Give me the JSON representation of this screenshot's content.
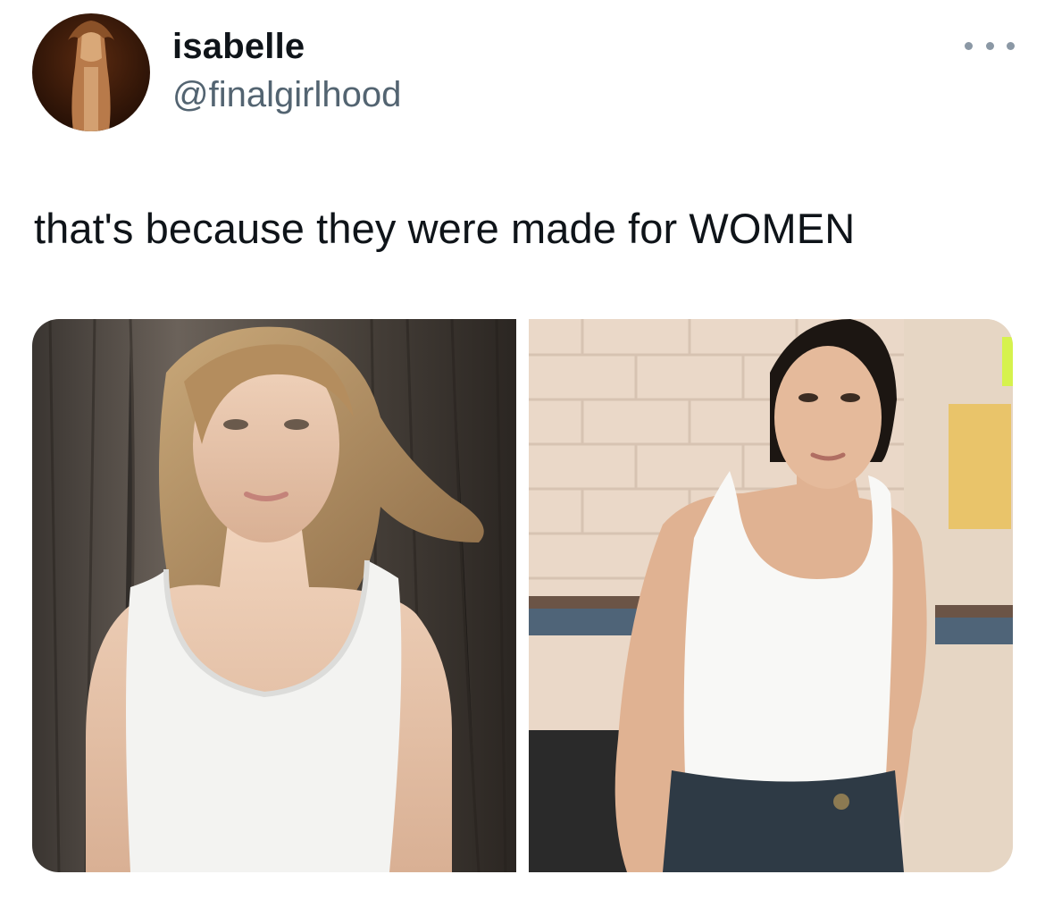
{
  "author": {
    "display_name": "isabelle",
    "handle": "@finalgirlhood",
    "avatar_icon": "profile-photo"
  },
  "menu": {
    "icon": "more-options-icon"
  },
  "tweet": {
    "text": "that's because they were made for WOMEN"
  },
  "media": {
    "photos": [
      {
        "icon": "photo-woman-white-tank-top-tree"
      },
      {
        "icon": "photo-woman-white-tank-top-brick-wall"
      }
    ]
  },
  "colors": {
    "text_primary": "#0f1419",
    "text_secondary": "#536471",
    "background": "#ffffff"
  }
}
